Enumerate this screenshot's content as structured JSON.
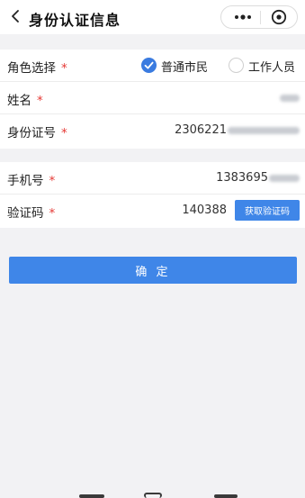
{
  "navbar": {
    "title": "身份认证信息",
    "back_icon": "chevron-left-icon",
    "more_icon": "more-dots-icon",
    "target_icon": "target-icon"
  },
  "form": {
    "role": {
      "label": "角色选择",
      "required_mark": "*",
      "options": [
        {
          "label": "普通市民",
          "checked": true
        },
        {
          "label": "工作人员",
          "checked": false
        }
      ]
    },
    "name": {
      "label": "姓名",
      "required_mark": "*",
      "value": "",
      "value_blurred": true
    },
    "id_number": {
      "label": "身份证号",
      "required_mark": "*",
      "value": "2306221",
      "value_blurred": true
    },
    "phone": {
      "label": "手机号",
      "required_mark": "*",
      "value": "1383695",
      "value_blurred": true
    },
    "code": {
      "label": "验证码",
      "required_mark": "*",
      "value": "140388",
      "button_label": "获取验证码"
    }
  },
  "confirm_label": "确 定",
  "colors": {
    "accent": "#3f86e8",
    "required": "#e53935",
    "background": "#f2f2f4"
  }
}
